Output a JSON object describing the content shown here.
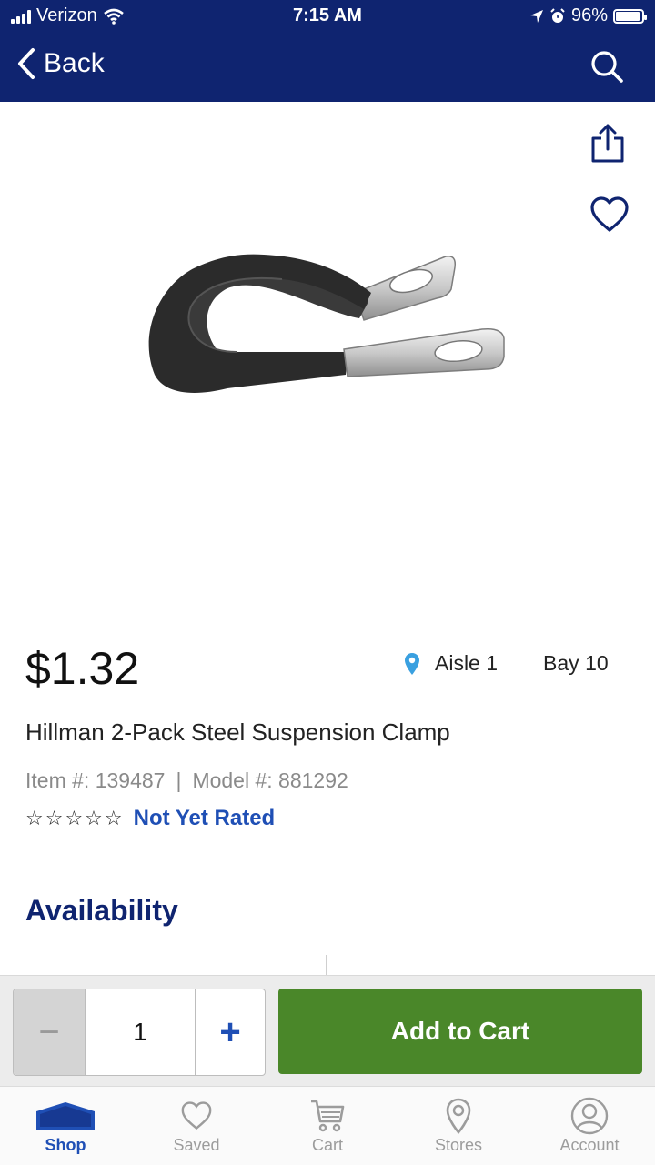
{
  "status_bar": {
    "carrier": "Verizon",
    "time": "7:15 AM",
    "battery": "96%"
  },
  "nav": {
    "back_label": "Back",
    "search_icon": "search-icon"
  },
  "hero": {
    "share_icon": "share-icon",
    "save_icon": "heart-icon",
    "image": "steel-suspension-clamp-image"
  },
  "product": {
    "price": "$1.32",
    "aisle": "Aisle 1",
    "bay": "Bay 10",
    "title": "Hillman 2-Pack Steel Suspension Clamp",
    "item_number": "Item #: 139487",
    "separator": "|",
    "model_number": "Model #: 881292",
    "stars": "☆☆☆☆☆",
    "rating_text": "Not Yet Rated"
  },
  "sections": {
    "availability": "Availability"
  },
  "cart_bar": {
    "minus": "−",
    "quantity": "1",
    "plus": "+",
    "add_to_cart": "Add to Cart"
  },
  "colors": {
    "nav_bg": "#0f2470",
    "add_to_cart_bg": "#4a8729",
    "link_blue": "#1f4fb5"
  },
  "tabs": [
    {
      "label": "Shop",
      "icon": "house-icon",
      "active": true
    },
    {
      "label": "Saved",
      "icon": "heart-icon",
      "active": false
    },
    {
      "label": "Cart",
      "icon": "cart-icon",
      "active": false
    },
    {
      "label": "Stores",
      "icon": "location-pin-icon",
      "active": false
    },
    {
      "label": "Account",
      "icon": "user-icon",
      "active": false
    }
  ]
}
